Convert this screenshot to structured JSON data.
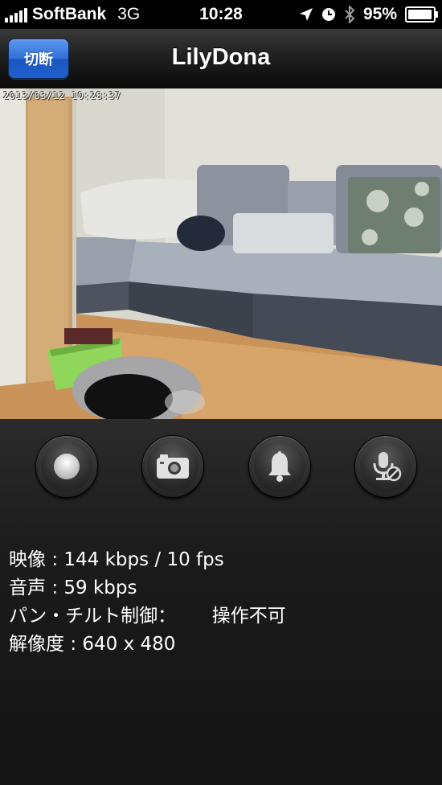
{
  "status_bar": {
    "carrier": "SoftBank",
    "network": "3G",
    "time": "10:28",
    "battery": "95%",
    "battery_level": 0.95
  },
  "nav": {
    "title": "LilyDona",
    "disconnect_label": "切断"
  },
  "camera": {
    "timestamp": "2013/03/12 10:28:37"
  },
  "controls": {
    "buttons": [
      {
        "icon": "record-icon"
      },
      {
        "icon": "camera-icon"
      },
      {
        "icon": "bell-icon"
      },
      {
        "icon": "microphone-muted-icon"
      }
    ]
  },
  "info": {
    "video_label": "映像",
    "video_value": "144 kbps / 10 fps",
    "audio_label": "音声",
    "audio_value": "59 kbps",
    "pantilt_label": "パン・チルト制御",
    "pantilt_value": "操作不可",
    "resolution_label": "解像度",
    "resolution_value": "640 x 480",
    "separator": ":",
    "pantilt_separator": "："
  }
}
